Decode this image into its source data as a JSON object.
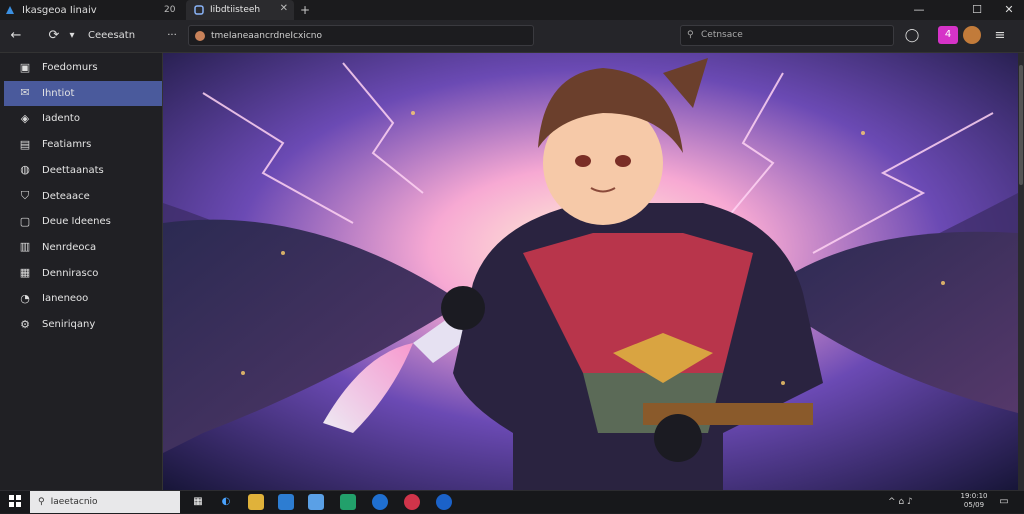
{
  "window": {
    "app_title": "Ikasgeoa Iinaiv",
    "tab_count": "20",
    "tab_title": "Iibdtiisteeh",
    "new_tab": "+",
    "controls": {
      "minimize": "—",
      "maximize": "☐",
      "close": "✕"
    }
  },
  "navbar": {
    "back_icon": "←",
    "refresh_icon": "⟳",
    "dropdown_icon": "▾",
    "label": "Ceeesatn",
    "more_icon": "···",
    "url": "tmeIaneaancrdneIcxicno",
    "search_placeholder": "Cetnsace",
    "extension_label": "4"
  },
  "sidebar": {
    "items": [
      {
        "label": "Foedomurs",
        "icon": "folder-icon",
        "glyph": "▣"
      },
      {
        "label": "Ihntiot",
        "icon": "mail-icon",
        "glyph": "✉"
      },
      {
        "label": "Iadento",
        "icon": "tag-icon",
        "glyph": "◈"
      },
      {
        "label": "Featiamrs",
        "icon": "document-icon",
        "glyph": "▤"
      },
      {
        "label": "Deettaanats",
        "icon": "globe-icon",
        "glyph": "◍"
      },
      {
        "label": "Deteaace",
        "icon": "shield-icon",
        "glyph": "⛉"
      },
      {
        "label": "Deue Ideenes",
        "icon": "file-icon",
        "glyph": "▢"
      },
      {
        "label": "Nenrdeoca",
        "icon": "bookmark-icon",
        "glyph": "▥"
      },
      {
        "label": "Dennirasco",
        "icon": "grid-icon",
        "glyph": "▦"
      },
      {
        "label": "Ianeneoo",
        "icon": "circle-icon",
        "glyph": "◔"
      },
      {
        "label": "Seniriqany",
        "icon": "settings-icon",
        "glyph": "⚙"
      }
    ],
    "active_index": 1
  },
  "taskbar": {
    "start_icon": "windows-logo-icon",
    "search_text": "Iaeetacnio",
    "tray_text": "^ ⌂ ♪",
    "time": "19:0:10",
    "date": "05/09"
  },
  "colors": {
    "accent": "#4a5a9c",
    "extension": "#d633c8"
  }
}
